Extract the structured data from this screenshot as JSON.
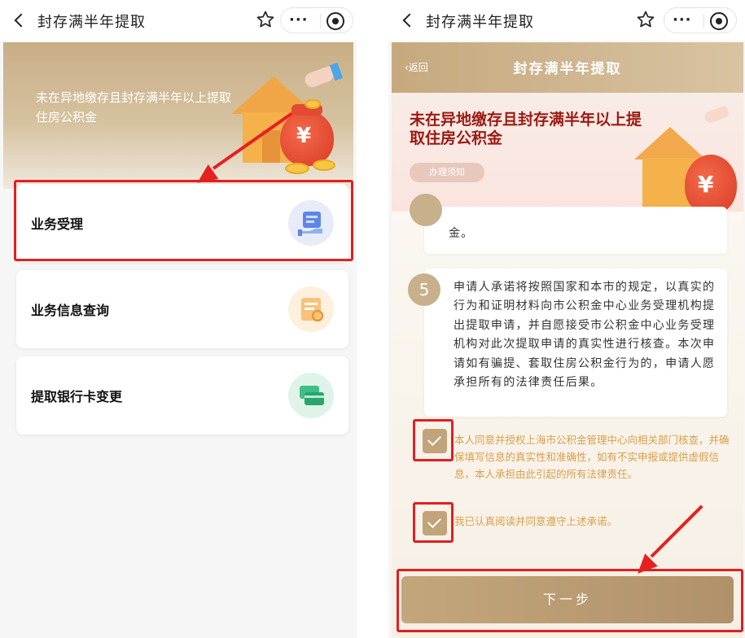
{
  "left_screen": {
    "titlebar": {
      "title": "封存满半年提取"
    },
    "banner": {
      "text": "未在异地缴存且封存满半年以上提取住房公积金"
    },
    "menu": [
      {
        "label": "业务受理",
        "icon": "service-hand-icon"
      },
      {
        "label": "业务信息查询",
        "icon": "query-document-icon"
      },
      {
        "label": "提取银行卡变更",
        "icon": "bank-card-icon"
      }
    ]
  },
  "right_screen": {
    "titlebar": {
      "title": "封存满半年提取"
    },
    "header": {
      "back": "‹返回",
      "title": "封存满半年提取"
    },
    "banner": {
      "title": "未在异地缴存且封存满半年以上提取住房公积金",
      "button": "办理须知"
    },
    "items": [
      {
        "number": "",
        "text": "金。"
      },
      {
        "number": "5",
        "text": "申请人承诺将按照国家和本市的规定，以真实的行为和证明材料向市公积金中心业务受理机构提出提取申请，并自愿接受市公积金中心业务受理机构对此次提取申请的真实性进行核查。本次申请如有骗提、套取住房公积金行为的，申请人愿承担所有的法律责任后果。"
      }
    ],
    "agreements": [
      {
        "text": "本人同意并授权上海市公积金管理中心向相关部门核查，并确保填写信息的真实性和准确性，如有不实申报或提供虚假信息，本人承担由此引起的所有法律责任。",
        "checked": true
      },
      {
        "text": "我已认真阅读并同意遵守上述承诺。",
        "checked": true
      }
    ],
    "next_button": "下一步"
  },
  "colors": {
    "highlight": "#e02020",
    "gold": "#c2a47a",
    "banner_red_text": "#9b1a12",
    "agree_text": "#d9a04c"
  }
}
